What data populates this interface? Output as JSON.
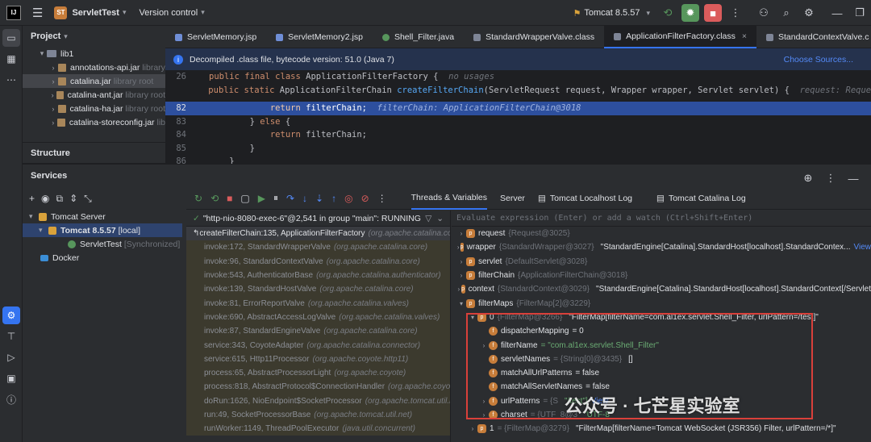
{
  "titlebar": {
    "project_badge": "ST",
    "project_name": "ServletTest",
    "version_control": "Version control",
    "run_config": "Tomcat 8.5.57"
  },
  "project_panel": {
    "title": "Project",
    "items": [
      {
        "label": "lib1",
        "lib": ""
      },
      {
        "label": "annotations-api.jar",
        "lib": "library"
      },
      {
        "label": "catalina.jar",
        "lib": "library root"
      },
      {
        "label": "catalina-ant.jar",
        "lib": "library root"
      },
      {
        "label": "catalina-ha.jar",
        "lib": "library root"
      },
      {
        "label": "catalina-storeconfig.jar",
        "lib": "lib"
      }
    ],
    "structure_label": "Structure"
  },
  "tabs": [
    "ServletMemory.jsp",
    "ServletMemory2.jsp",
    "Shell_Filter.java",
    "StandardWrapperValve.class",
    "ApplicationFilterFactory.class",
    "StandardContextValve.c"
  ],
  "banner": {
    "text": "Decompiled .class file, bytecode version: 51.0 (Java 7)",
    "link": "Choose Sources..."
  },
  "code": [
    {
      "ln": "26",
      "text": "public final class ApplicationFilterFactory {",
      "hint": "no usages"
    },
    {
      "ln": "",
      "text": "    public static ApplicationFilterChain createFilterChain(ServletRequest request, Wrapper wrapper, Servlet servlet) {",
      "hint": "request: Request@3025"
    },
    {
      "ln": "82",
      "text": "            return filterChain;",
      "hint": "filterChain: ApplicationFilterChain@3018"
    },
    {
      "ln": "83",
      "text": "        } else {",
      "hint": ""
    },
    {
      "ln": "84",
      "text": "            return filterChain;",
      "hint": ""
    },
    {
      "ln": "85",
      "text": "        }",
      "hint": ""
    },
    {
      "ln": "86",
      "text": "    }",
      "hint": ""
    }
  ],
  "services": {
    "title": "Services",
    "tree": [
      {
        "label": "Tomcat Server",
        "extra": ""
      },
      {
        "label": "Tomcat 8.5.57",
        "extra": "[local]"
      },
      {
        "label": "ServletTest",
        "extra": "[Synchronized]"
      },
      {
        "label": "Docker",
        "extra": ""
      }
    ],
    "debug_tabs": [
      "Threads & Variables",
      "Server",
      "Tomcat Localhost Log",
      "Tomcat Catalina Log"
    ],
    "thread": "\"http-nio-8080-exec-6\"@2,541 in group \"main\": RUNNING",
    "eval_placeholder": "Evaluate expression (Enter) or add a watch (Ctrl+Shift+Enter)"
  },
  "frames": [
    {
      "m": "createFilterChain:135, ApplicationFilterFactory",
      "p": "(org.apache.catalina.core)"
    },
    {
      "m": "invoke:172, StandardWrapperValve",
      "p": "(org.apache.catalina.core)"
    },
    {
      "m": "invoke:96, StandardContextValve",
      "p": "(org.apache.catalina.core)"
    },
    {
      "m": "invoke:543, AuthenticatorBase",
      "p": "(org.apache.catalina.authenticator)"
    },
    {
      "m": "invoke:139, StandardHostValve",
      "p": "(org.apache.catalina.core)"
    },
    {
      "m": "invoke:81, ErrorReportValve",
      "p": "(org.apache.catalina.valves)"
    },
    {
      "m": "invoke:690, AbstractAccessLogValve",
      "p": "(org.apache.catalina.valves)"
    },
    {
      "m": "invoke:87, StandardEngineValve",
      "p": "(org.apache.catalina.core)"
    },
    {
      "m": "service:343, CoyoteAdapter",
      "p": "(org.apache.catalina.connector)"
    },
    {
      "m": "service:615, Http11Processor",
      "p": "(org.apache.coyote.http11)"
    },
    {
      "m": "process:65, AbstractProcessorLight",
      "p": "(org.apache.coyote)"
    },
    {
      "m": "process:818, AbstractProtocol$ConnectionHandler",
      "p": "(org.apache.coyote)"
    },
    {
      "m": "doRun:1626, NioEndpoint$SocketProcessor",
      "p": "(org.apache.tomcat.util.net)"
    },
    {
      "m": "run:49, SocketProcessorBase",
      "p": "(org.apache.tomcat.util.net)"
    },
    {
      "m": "runWorker:1149, ThreadPoolExecutor",
      "p": "(java.util.concurrent)"
    }
  ],
  "vars": [
    {
      "name": "request",
      "id": "{Request@3025}",
      "val": ""
    },
    {
      "name": "wrapper",
      "id": "{StandardWrapper@3027}",
      "val": "\"StandardEngine[Catalina].StandardHost[localhost].StandardContex...",
      "link": "View"
    },
    {
      "name": "servlet",
      "id": "{DefaultServlet@3028}",
      "val": ""
    },
    {
      "name": "filterChain",
      "id": "{ApplicationFilterChain@3018}",
      "val": ""
    },
    {
      "name": "context",
      "id": "{StandardContext@3029}",
      "val": "\"StandardEngine[Catalina].StandardHost[localhost].StandardContext[/Servlet"
    },
    {
      "name": "filterMaps",
      "id": "{FilterMap[2]@3229}",
      "val": ""
    },
    {
      "name": "0",
      "id": "{FilterMap@3266}",
      "val": "\"FilterMap[filterName=com.al1ex.servlet.Shell_Filter, urlPattern=/test]\""
    },
    {
      "name": "dispatcherMapping",
      "id": "",
      "val": "= 0"
    },
    {
      "name": "filterName",
      "id": "",
      "val": "= \"com.al1ex.servlet.Shell_Filter\""
    },
    {
      "name": "servletNames",
      "id": "= {String[0]@3435}",
      "val": "[]"
    },
    {
      "name": "matchAllUrlPatterns",
      "id": "",
      "val": "= false"
    },
    {
      "name": "matchAllServletNames",
      "id": "",
      "val": "= false"
    },
    {
      "name": "urlPatterns",
      "id": "= {S",
      "val": "\"/test\"]",
      "link": "View"
    },
    {
      "name": "charset",
      "id": "= {UTF_8@3",
      "val": "\"UTF-8\""
    },
    {
      "name": "1",
      "id": "= {FilterMap@3279}",
      "val": "\"FilterMap[filterName=Tomcat WebSocket (JSR356) Filter, urlPattern=/*]\""
    }
  ],
  "watermark": "公众号 · 七芒星实验室"
}
